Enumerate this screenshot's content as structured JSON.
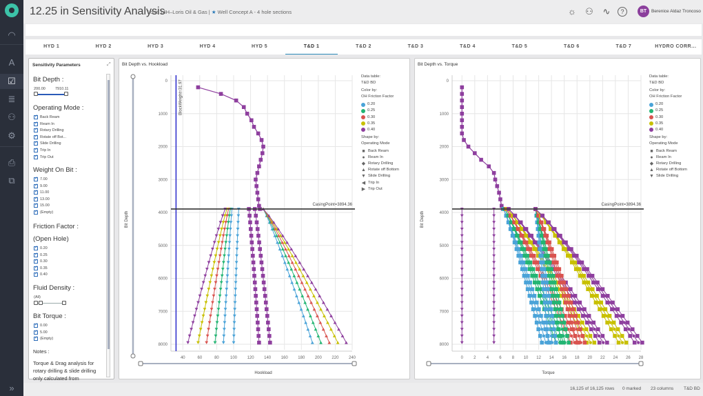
{
  "app": {
    "title": "12.25 in Sensitivity Analysis",
    "project": "Loris 14H–Loris Oil & Gas",
    "separator": "|",
    "concept_icon": "★",
    "concept": "Well Concept A - 4 hole sections"
  },
  "header_icons": [
    "lightbulb-icon",
    "users-icon",
    "activity-icon",
    "help-icon"
  ],
  "user": {
    "initials": "BT",
    "name": "Berenice Aldaz Troncoso",
    "caret": "▼",
    "avatar_color": "#8b3f9c"
  },
  "rail": {
    "items": [
      {
        "name": "dashboard-icon",
        "glyph": "◠"
      },
      {
        "name": "well-icon",
        "glyph": "A"
      },
      {
        "name": "analysis-icon",
        "glyph": "☑"
      },
      {
        "name": "documents-icon",
        "glyph": "≣"
      },
      {
        "name": "team-icon",
        "glyph": "⚇"
      },
      {
        "name": "settings-icon",
        "glyph": "⚙"
      },
      {
        "name": "report-icon",
        "glyph": "⎙"
      },
      {
        "name": "transfer-icon",
        "glyph": "⧉"
      }
    ],
    "expand": "»"
  },
  "tabs": [
    "HYD 1",
    "HYD 2",
    "HYD 3",
    "HYD 4",
    "HYD 5",
    "T&D 1",
    "T&D 2",
    "T&D 3",
    "T&D 4",
    "T&D 5",
    "T&D 6",
    "T&D 7",
    "HYDRO CORR..."
  ],
  "active_tab": "T&D 1",
  "sensitivity": {
    "title": "Sensitivity Parameters",
    "expand_icon": "⤢",
    "bit_depth": {
      "label": "Bit Depth :",
      "min": "200.00",
      "max": "7910.11"
    },
    "operating_mode": {
      "label": "Operating Mode :",
      "items": [
        "Back Ream",
        "Ream In",
        "Rotary Drilling",
        "Rotate off Bot...",
        "Slide Drilling",
        "Trip In",
        "Trip Out"
      ]
    },
    "weight_on_bit": {
      "label": "Weight On Bit :",
      "items": [
        "7.00",
        "9.00",
        "11.00",
        "13.00",
        "15.00",
        "(Empty)"
      ]
    },
    "friction_factor": {
      "label": "Friction Factor :",
      "sublabel": "(Open Hole)",
      "items": [
        "0.20",
        "0.25",
        "0.30",
        "0.35",
        "0.40"
      ]
    },
    "fluid_density": {
      "label": "Fluid Density :",
      "value": "(All)"
    },
    "bit_torque": {
      "label": "Bit Torque :",
      "items": [
        "0.00",
        "5.00",
        "(Empty)"
      ]
    },
    "notes": {
      "label": "Notes :",
      "text": "Torque & Drag analysis for rotary drilling & slide drilling only calculated from"
    }
  },
  "legend_common": {
    "data_table_label": "Data table:",
    "data_table": "T&D BD",
    "color_by_label": "Color by:",
    "color_by": "OH Friction Factor",
    "shape_by_label": "Shape by:",
    "shape_by": "Operating Mode",
    "colors": [
      {
        "label": "0.20",
        "color": "#4aa3d8"
      },
      {
        "label": "0.25",
        "color": "#22b573"
      },
      {
        "label": "0.30",
        "color": "#d9534f"
      },
      {
        "label": "0.35",
        "color": "#c8c000"
      },
      {
        "label": "0.40",
        "color": "#8e3f9e"
      }
    ]
  },
  "chart_data": [
    {
      "type": "scatter",
      "title": "Bit Depth vs. Hookload",
      "xlabel": "Hookload",
      "ylabel": "Bit Depth",
      "xlim": [
        30,
        240
      ],
      "ylim": [
        8000,
        0
      ],
      "xticks": [
        "40",
        "60",
        "80",
        "100",
        "120",
        "140",
        "160",
        "180",
        "200",
        "220",
        "240"
      ],
      "yticks": [
        "0",
        "1000",
        "2000",
        "3000",
        "4000",
        "5000",
        "6000",
        "7000",
        "8000"
      ],
      "reference_lines": [
        {
          "orientation": "vertical",
          "label": "BlockWeight=31.97",
          "value": 31.97,
          "color": "#3333cc"
        },
        {
          "orientation": "horizontal",
          "label": "CasingPoint=3894.36",
          "value": 3894.36,
          "color": "#333333"
        }
      ],
      "shapes": [
        {
          "label": "Back Ream",
          "glyph": "■"
        },
        {
          "label": "Ream In",
          "glyph": "●"
        },
        {
          "label": "Rotary Drilling",
          "glyph": "◆"
        },
        {
          "label": "Rotate off Bottom",
          "glyph": "▲"
        },
        {
          "label": "Slide Drilling",
          "glyph": "▼"
        },
        {
          "label": "Trip In",
          "glyph": "◀"
        },
        {
          "label": "Trip Out",
          "glyph": "▶"
        }
      ],
      "cased_path": {
        "depth": [
          200,
          400,
          600,
          800,
          1000,
          1200,
          1400,
          1600,
          1800,
          2000,
          2200,
          2400,
          2600,
          2800,
          3000,
          3200,
          3400,
          3600,
          3800,
          3894
        ],
        "hookload": [
          58,
          85,
          103,
          112,
          116,
          121,
          124,
          129,
          133,
          135,
          134,
          132,
          130,
          128,
          126,
          127,
          128,
          129,
          130,
          131
        ]
      },
      "series": [
        {
          "name": "Trip Out / Rotate off Bottom 0.20",
          "color": "#4aa3d8",
          "start": [
            135,
            3894
          ],
          "end": [
            193,
            7950
          ]
        },
        {
          "name": "Trip Out 0.25",
          "color": "#22b573",
          "start": [
            135,
            3894
          ],
          "end": [
            203,
            7950
          ]
        },
        {
          "name": "Trip Out 0.30",
          "color": "#d9534f",
          "start": [
            135,
            3894
          ],
          "end": [
            213,
            7950
          ]
        },
        {
          "name": "Trip Out 0.35",
          "color": "#c8c000",
          "start": [
            135,
            3894
          ],
          "end": [
            223,
            7950
          ]
        },
        {
          "name": "Trip Out 0.40",
          "color": "#8e3f9e",
          "start": [
            135,
            3894
          ],
          "end": [
            233,
            7950
          ]
        },
        {
          "name": "Rotary band (purple)",
          "color": "#8e3f9e",
          "start": [
            118,
            3894
          ],
          "end": [
            130,
            7950
          ]
        },
        {
          "name": "Rotary band 2 (purple)",
          "color": "#8e3f9e",
          "start": [
            125,
            3894
          ],
          "end": [
            143,
            7950
          ]
        },
        {
          "name": "Trip In 0.20",
          "color": "#4aa3d8",
          "start": [
            106,
            3894
          ],
          "end": [
            100,
            7950
          ]
        },
        {
          "name": "Slide 0.20",
          "color": "#4aa3d8",
          "start": [
            98,
            3894
          ],
          "end": [
            88,
            7950
          ]
        },
        {
          "name": "Slide 0.25",
          "color": "#22b573",
          "start": [
            96,
            3894
          ],
          "end": [
            78,
            7950
          ]
        },
        {
          "name": "Slide 0.30",
          "color": "#d9534f",
          "start": [
            94,
            3894
          ],
          "end": [
            68,
            7950
          ]
        },
        {
          "name": "Slide 0.35",
          "color": "#c8c000",
          "start": [
            92,
            3894
          ],
          "end": [
            58,
            7950
          ]
        },
        {
          "name": "Slide 0.40",
          "color": "#8e3f9e",
          "start": [
            90,
            3894
          ],
          "end": [
            46,
            7950
          ]
        }
      ]
    },
    {
      "type": "scatter",
      "title": "Bit Depth vs. Torque",
      "xlabel": "Torque",
      "ylabel": "Bit Depth",
      "xlim": [
        -1,
        28
      ],
      "ylim": [
        8000,
        0
      ],
      "xticks": [
        "0",
        "2",
        "4",
        "6",
        "8",
        "10",
        "12",
        "14",
        "16",
        "18",
        "20",
        "22",
        "24",
        "26",
        "28"
      ],
      "yticks": [
        "0",
        "1000",
        "2000",
        "3000",
        "4000",
        "5000",
        "6000",
        "7000",
        "8000"
      ],
      "reference_lines": [
        {
          "orientation": "horizontal",
          "label": "CasingPoint=3894.36",
          "value": 3894.36,
          "color": "#333333"
        }
      ],
      "shapes": [
        {
          "label": "Back Ream",
          "glyph": "■"
        },
        {
          "label": "Ream In",
          "glyph": "●"
        },
        {
          "label": "Rotary Drilling",
          "glyph": "◆"
        },
        {
          "label": "Rotate off Bottom",
          "glyph": "▲"
        },
        {
          "label": "Slide Drilling",
          "glyph": "▼"
        }
      ],
      "cased_path": {
        "depth": [
          200,
          400,
          600,
          800,
          1000,
          1200,
          1400,
          1600,
          1800,
          2000,
          2200,
          2400,
          2600,
          2800,
          3000,
          3200,
          3400,
          3600,
          3800,
          3894
        ],
        "torque": [
          0,
          0,
          0,
          0,
          0,
          0,
          0,
          0,
          0.3,
          1,
          2,
          3,
          4.2,
          5,
          5.2,
          5.5,
          5.8,
          6,
          6.2,
          6.4
        ]
      },
      "vertical_series": [
        {
          "name": "Slide 0",
          "color": "#8e3f9e",
          "torque": 0
        },
        {
          "name": "Slide 5",
          "color": "#8e3f9e",
          "torque": 5
        }
      ],
      "series": [
        {
          "name": "0.20 low",
          "color": "#4aa3d8",
          "start": [
            6.5,
            3894
          ],
          "end": [
            12.5,
            7950
          ]
        },
        {
          "name": "0.25 low",
          "color": "#22b573",
          "start": [
            6.7,
            3894
          ],
          "end": [
            14.7,
            7950
          ]
        },
        {
          "name": "0.30 low",
          "color": "#d9534f",
          "start": [
            6.9,
            3894
          ],
          "end": [
            17,
            7950
          ]
        },
        {
          "name": "0.35 low",
          "color": "#c8c000",
          "start": [
            7.1,
            3894
          ],
          "end": [
            19.5,
            7950
          ]
        },
        {
          "name": "0.40 low",
          "color": "#8e3f9e",
          "start": [
            7.3,
            3894
          ],
          "end": [
            21.5,
            7950
          ]
        },
        {
          "name": "0.20 high",
          "color": "#4aa3d8",
          "start": [
            11.5,
            3894
          ],
          "end": [
            13.5,
            7950
          ]
        },
        {
          "name": "0.25 high",
          "color": "#22b573",
          "start": [
            11.5,
            3894
          ],
          "end": [
            15.5,
            7950
          ]
        },
        {
          "name": "0.30 high",
          "color": "#d9534f",
          "start": [
            11.5,
            3894
          ],
          "end": [
            18,
            7950
          ]
        },
        {
          "name": "0.35 high",
          "color": "#c8c000",
          "start": [
            11.5,
            3894
          ],
          "end": [
            24.5,
            7950
          ]
        },
        {
          "name": "0.40 high",
          "color": "#8e3f9e",
          "start": [
            11.5,
            3894
          ],
          "end": [
            27,
            7950
          ]
        }
      ]
    }
  ],
  "status": {
    "rows": "16,125 of 16,125 rows",
    "marked": "0 marked",
    "columns": "23 columns",
    "table": "T&D BD"
  }
}
